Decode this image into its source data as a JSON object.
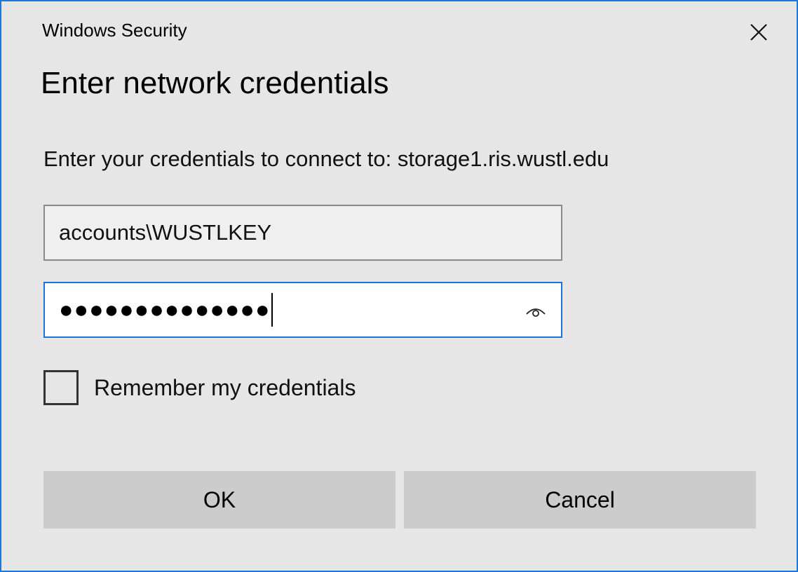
{
  "window": {
    "title": "Windows Security"
  },
  "dialog": {
    "heading": "Enter network credentials",
    "message": "Enter your credentials to connect to: storage1.ris.wustl.edu"
  },
  "username": {
    "value": "accounts\\WUSTLKEY"
  },
  "password": {
    "masked_value": "●●●●●●●●●●●●●●",
    "reveal_icon": "eye-icon"
  },
  "remember": {
    "label": "Remember my credentials",
    "checked": false
  },
  "buttons": {
    "ok_label": "OK",
    "cancel_label": "Cancel"
  },
  "colors": {
    "accent": "#1a73d9",
    "background": "#e6e6e6",
    "button": "#cccccc"
  }
}
